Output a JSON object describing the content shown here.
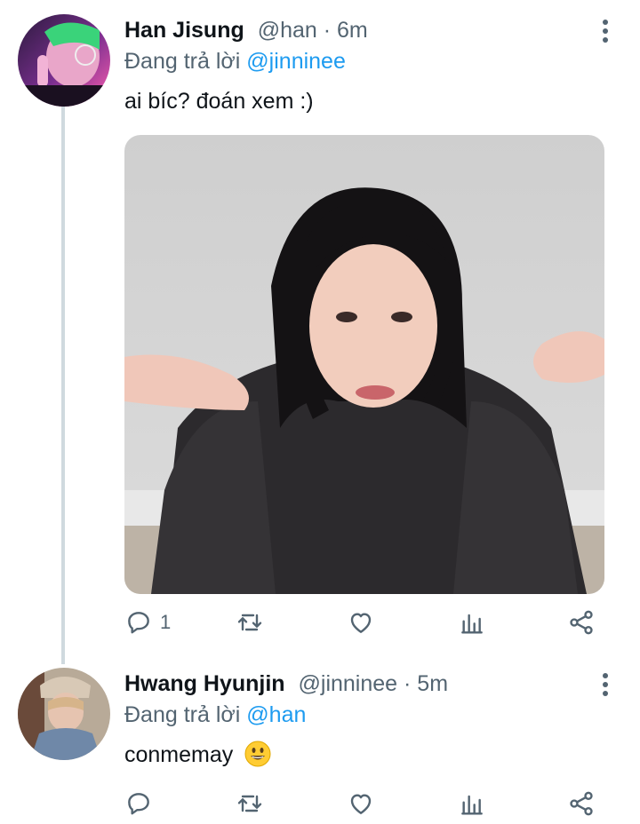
{
  "colors": {
    "accent": "#1d9bf0",
    "muted": "#536471",
    "text": "#0f1419",
    "thread_line": "#cfd9de"
  },
  "tweets": [
    {
      "name": "Han Jisung",
      "handle": "@han",
      "time": "· 6m",
      "replying_prefix": "Đang trả lời",
      "replying_to": "@jinninee",
      "text": "ai bíc? đoán xem :)",
      "reply_count": "1",
      "has_media": true
    },
    {
      "name": "Hwang Hyunjin",
      "handle": "@jinninee",
      "time": "· 5m",
      "replying_prefix": "Đang trả lời",
      "replying_to": "@han",
      "text": "conmemay",
      "emoji": "grinning-face",
      "reply_count": ""
    }
  ],
  "icons": [
    "reply-icon",
    "retweet-icon",
    "like-icon",
    "analytics-icon",
    "share-icon",
    "more-icon"
  ]
}
